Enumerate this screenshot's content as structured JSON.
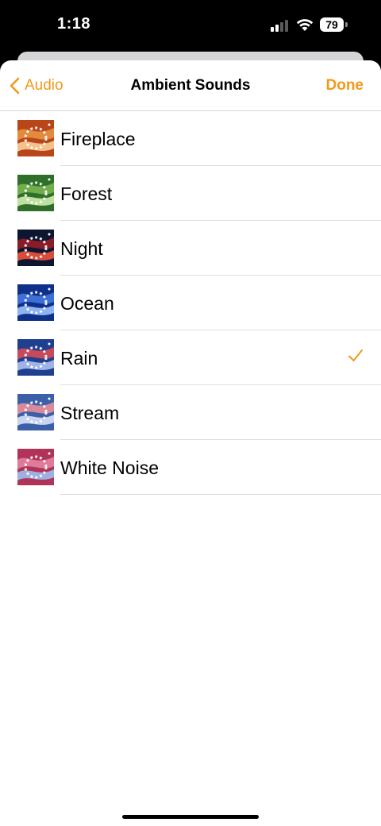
{
  "status_bar": {
    "time": "1:18",
    "battery_level": "79"
  },
  "nav": {
    "back_label": "Audio",
    "title": "Ambient Sounds",
    "done_label": "Done"
  },
  "colors": {
    "accent": "#f19a1a"
  },
  "sounds": [
    {
      "label": "Fireplace",
      "selected": false,
      "thumb_colors": [
        "#b8461a",
        "#e38a3d",
        "#f4c18a"
      ]
    },
    {
      "label": "Forest",
      "selected": false,
      "thumb_colors": [
        "#2f6f2a",
        "#6fae4a",
        "#bfe0a0"
      ]
    },
    {
      "label": "Night",
      "selected": false,
      "thumb_colors": [
        "#0d1630",
        "#8a1c2a",
        "#d94b3a"
      ]
    },
    {
      "label": "Ocean",
      "selected": false,
      "thumb_colors": [
        "#0e2f8a",
        "#3d6fd6",
        "#8fb2f0"
      ]
    },
    {
      "label": "Rain",
      "selected": true,
      "thumb_colors": [
        "#1f3f8f",
        "#c84a5a",
        "#9fb3e8"
      ]
    },
    {
      "label": "Stream",
      "selected": false,
      "thumb_colors": [
        "#3b5fa8",
        "#d98a9a",
        "#c8d4f0"
      ]
    },
    {
      "label": "White Noise",
      "selected": false,
      "thumb_colors": [
        "#b0335a",
        "#e07a9a",
        "#9fb0e0"
      ]
    }
  ]
}
